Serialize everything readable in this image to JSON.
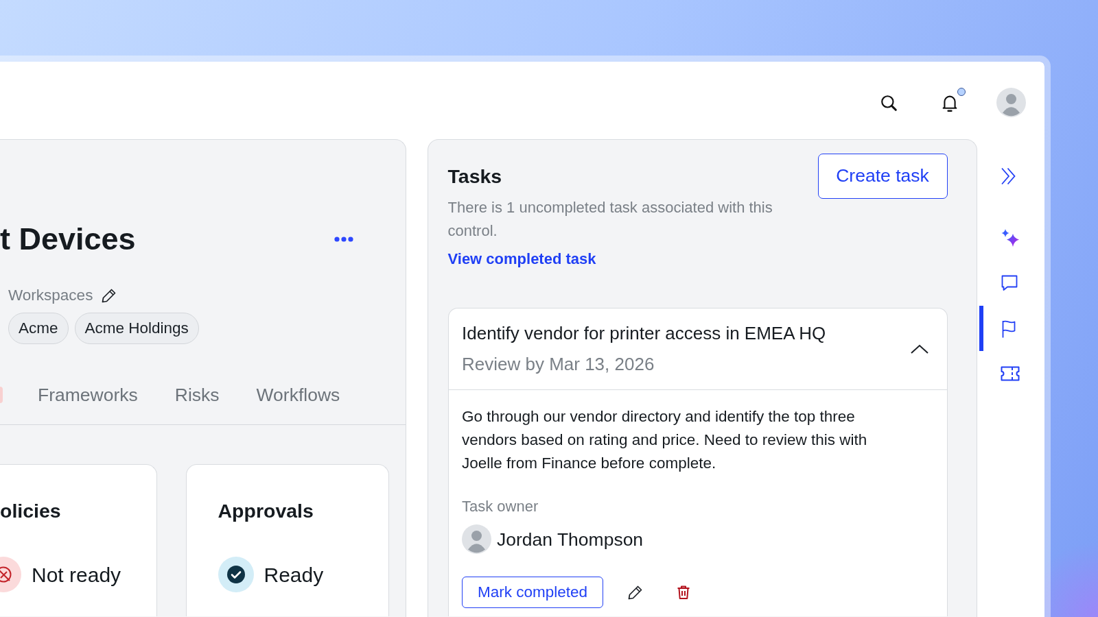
{
  "header": {
    "unread_notifications": true
  },
  "control": {
    "title": "t Devices",
    "workspaces_label": "Workspaces",
    "workspaces": [
      "Acme",
      "Acme Holdings"
    ],
    "tabs": [
      {
        "label": "Frameworks",
        "selected": false
      },
      {
        "label": "Risks",
        "selected": false
      },
      {
        "label": "Workflows",
        "selected": false
      }
    ],
    "readiness": [
      {
        "title": "olicies",
        "status": "Not ready",
        "kind": "not_ready"
      },
      {
        "title": "Approvals",
        "status": "Ready",
        "kind": "ready"
      }
    ]
  },
  "tasks": {
    "title": "Tasks",
    "create_button": "Create task",
    "summary": "There is 1 uncompleted task associated with this control.",
    "view_completed_link": "View completed task",
    "items": [
      {
        "title": "Identify vendor for printer access in EMEA HQ",
        "due": "Review by Mar 13, 2026",
        "expanded": true,
        "description": "Go through our vendor directory and identify the top three vendors based on rating and price. Need to review this with Joelle from Finance before complete.",
        "owner_label": "Task owner",
        "owner": "Jordan Thompson",
        "complete_button": "Mark completed"
      }
    ]
  },
  "rail": [
    {
      "kind": "collapse",
      "selected": false
    },
    {
      "kind": "ai",
      "selected": false
    },
    {
      "kind": "comments",
      "selected": false
    },
    {
      "kind": "flag",
      "selected": true
    },
    {
      "kind": "ticket",
      "selected": false
    }
  ]
}
